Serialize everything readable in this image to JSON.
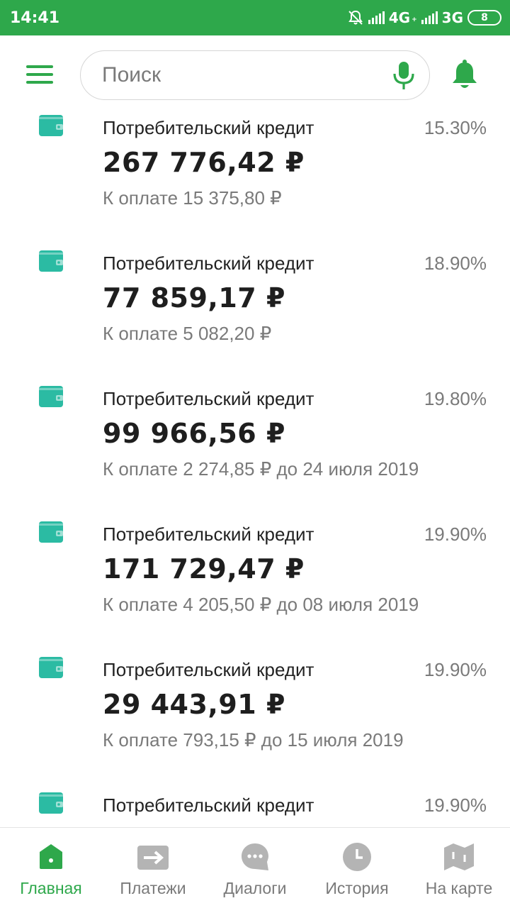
{
  "status_bar": {
    "time": "14:41",
    "network_1": "4G",
    "network_1_sub": "+",
    "network_2": "3G",
    "battery": "8"
  },
  "header": {
    "search_placeholder": "Поиск",
    "accent_color": "#2ea84b"
  },
  "loans": [
    {
      "title": "Потребительский кредит",
      "rate": "15.30%",
      "amount": "267 776,42 ₽",
      "payment": "К оплате 15 375,80 ₽"
    },
    {
      "title": "Потребительский кредит",
      "rate": "18.90%",
      "amount": "77 859,17 ₽",
      "payment": "К оплате 5 082,20 ₽"
    },
    {
      "title": "Потребительский кредит",
      "rate": "19.80%",
      "amount": "99 966,56 ₽",
      "payment": "К оплате 2 274,85 ₽ до 24 июля 2019"
    },
    {
      "title": "Потребительский кредит",
      "rate": "19.90%",
      "amount": "171 729,47 ₽",
      "payment": "К оплате 4 205,50 ₽ до 08 июля 2019"
    },
    {
      "title": "Потребительский кредит",
      "rate": "19.90%",
      "amount": "29 443,91 ₽",
      "payment": "К оплате 793,15 ₽ до 15 июля 2019"
    },
    {
      "title": "Потребительский кредит",
      "rate": "19.90%",
      "amount": "",
      "payment": ""
    }
  ],
  "bottom_nav": [
    {
      "label": "Главная",
      "icon": "home-icon",
      "active": true
    },
    {
      "label": "Платежи",
      "icon": "transfer-icon",
      "active": false
    },
    {
      "label": "Диалоги",
      "icon": "chat-icon",
      "active": false
    },
    {
      "label": "История",
      "icon": "clock-icon",
      "active": false
    },
    {
      "label": "На карте",
      "icon": "map-icon",
      "active": false
    }
  ],
  "colors": {
    "accent": "#2ea84b",
    "wallet": "#2bbba3",
    "inactive_nav": "#b4b4b4"
  }
}
